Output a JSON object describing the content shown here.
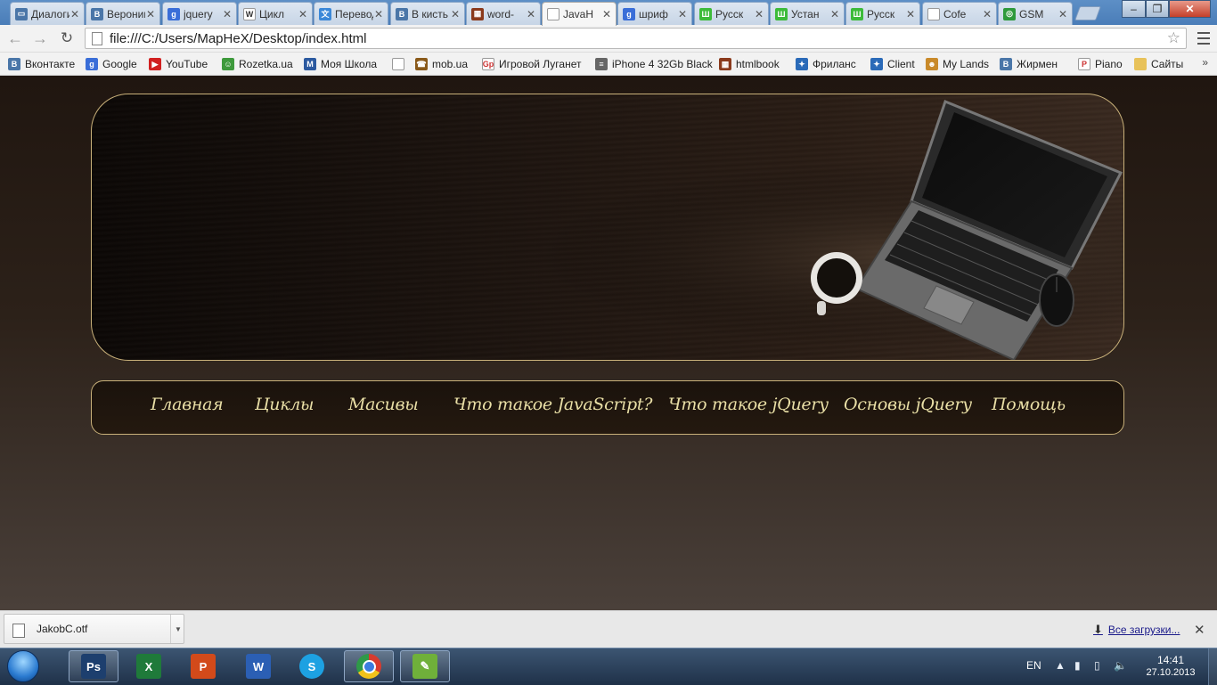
{
  "browser": {
    "tabs": [
      {
        "title": "Диалоги",
        "favicon": "vk-chat-icon",
        "color": "#4a76a8",
        "glyph": "▭"
      },
      {
        "title": "Вероника",
        "favicon": "vk-icon",
        "color": "#4a76a8",
        "glyph": "B"
      },
      {
        "title": "jquery",
        "favicon": "google-icon",
        "color": "#3a6ed8",
        "glyph": "g"
      },
      {
        "title": "Цикл",
        "favicon": "wikipedia-icon",
        "color": "#ffffff",
        "glyph": "W"
      },
      {
        "title": "Перевод",
        "favicon": "translate-icon",
        "color": "#3b88d8",
        "glyph": "文"
      },
      {
        "title": "В кисть",
        "favicon": "vk-icon",
        "color": "#4a76a8",
        "glyph": "B"
      },
      {
        "title": "word-",
        "favicon": "htmlbook-icon",
        "color": "#8b3a1c",
        "glyph": "▦"
      },
      {
        "title": "JavaH",
        "favicon": "page-icon",
        "color": "#ffffff",
        "glyph": ""
      },
      {
        "title": "шриф",
        "favicon": "google-icon",
        "color": "#3a6ed8",
        "glyph": "g"
      },
      {
        "title": "Русск",
        "favicon": "shkola-icon",
        "color": "#3dbb3a",
        "glyph": "Ш"
      },
      {
        "title": "Устан",
        "favicon": "shkola-icon",
        "color": "#3dbb3a",
        "glyph": "Ш"
      },
      {
        "title": "Русск",
        "favicon": "shkola-icon",
        "color": "#3dbb3a",
        "glyph": "Ш"
      },
      {
        "title": "Cofe",
        "favicon": "page-icon",
        "color": "#ffffff",
        "glyph": ""
      },
      {
        "title": "GSM",
        "favicon": "gsm-icon",
        "color": "#2e9a3c",
        "glyph": "◎"
      }
    ],
    "active_tab_index": 7,
    "address": "file:///C:/Users/MapHeX/Desktop/index.html",
    "bookmarks": [
      {
        "label": "Вконтакте",
        "icon": "vk-icon",
        "color": "#4a76a8",
        "glyph": "B"
      },
      {
        "label": "Google",
        "icon": "google-icon",
        "color": "#3a6ed8",
        "glyph": "g"
      },
      {
        "label": "YouTube",
        "icon": "youtube-icon",
        "color": "#d12020",
        "glyph": "▶"
      },
      {
        "label": "Rozetka.ua",
        "icon": "rozetka-icon",
        "color": "#3e9a3c",
        "glyph": "☺"
      },
      {
        "label": "Моя Школа",
        "icon": "myschool-icon",
        "color": "#2c5aa0",
        "glyph": "M"
      },
      {
        "label": "",
        "icon": "page-icon",
        "color": "#ffffff",
        "glyph": ""
      },
      {
        "label": "mob.ua",
        "icon": "mob-icon",
        "color": "#8a5a1a",
        "glyph": "☎"
      },
      {
        "label": "Игровой Луганет",
        "icon": "gp-icon",
        "color": "#ffffff",
        "glyph": "Gp"
      },
      {
        "label": "iPhone 4 32Gb Black",
        "icon": "iphone-icon",
        "color": "#666666",
        "glyph": "≡"
      },
      {
        "label": "htmlbook",
        "icon": "htmlbook-icon",
        "color": "#8b3a1c",
        "glyph": "▦"
      },
      {
        "label": "Фриланс",
        "icon": "freelance-icon",
        "color": "#2a6ab8",
        "glyph": "✦"
      },
      {
        "label": "Client",
        "icon": "freelance-icon",
        "color": "#2a6ab8",
        "glyph": "✦"
      },
      {
        "label": "My Lands",
        "icon": "mylands-icon",
        "color": "#c98a2a",
        "glyph": "☻"
      },
      {
        "label": "Жирмен",
        "icon": "vk-icon",
        "color": "#4a76a8",
        "glyph": "B"
      },
      {
        "label": "Piano",
        "icon": "piano-icon",
        "color": "#ffffff",
        "glyph": "P"
      },
      {
        "label": "Сайты",
        "icon": "folder-icon",
        "color": "#e8c25a",
        "glyph": ""
      }
    ]
  },
  "site": {
    "nav": [
      "Главная",
      "Циклы",
      "Масивы",
      "Что такое JavaScript?",
      "Что такое jQuery",
      "Основы jQuery",
      "Помощь"
    ]
  },
  "downloads": {
    "file": "JakobC.otf",
    "show_all": "Все загрузки..."
  },
  "taskbar": {
    "apps": [
      {
        "name": "photoshop",
        "label": "Ps",
        "color": "#1d3f6e",
        "open": true
      },
      {
        "name": "excel",
        "label": "X",
        "color": "#1f7a3a",
        "open": false
      },
      {
        "name": "powerpoint",
        "label": "P",
        "color": "#d24a1a",
        "open": false
      },
      {
        "name": "word",
        "label": "W",
        "color": "#2b5fb4",
        "open": false
      },
      {
        "name": "skype",
        "label": "S",
        "color": "#1da1e2",
        "open": false
      },
      {
        "name": "chrome",
        "label": "",
        "color": "#dddddd",
        "open": true
      },
      {
        "name": "editor",
        "label": "✎",
        "color": "#6fb03a",
        "open": true
      }
    ],
    "lang": "EN",
    "time": "14:41",
    "date": "27.10.2013"
  }
}
